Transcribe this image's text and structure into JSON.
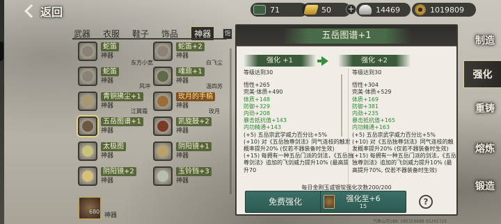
{
  "top": {
    "back_label": "返回",
    "currencies": [
      {
        "name": "ticket",
        "value": "71",
        "icon": "ticket-icon"
      },
      {
        "name": "gold-ingot",
        "value": "50",
        "icon": "gold-ingot-icon"
      },
      {
        "name": "silver",
        "value": "14469",
        "icon": "silver-ingot-icon"
      },
      {
        "name": "copper",
        "value": "1019809",
        "icon": "copper-coin-icon"
      }
    ],
    "plus": "+"
  },
  "categories": [
    {
      "label": "武器",
      "active": false
    },
    {
      "label": "衣服",
      "active": false
    },
    {
      "label": "鞋子",
      "active": false
    },
    {
      "label": "饰品",
      "active": false
    },
    {
      "label": "神器",
      "active": true
    }
  ],
  "filter_icon_label": "饱",
  "items": [
    {
      "name": "蛇笛",
      "type": "神器",
      "owner": "东方小宽"
    },
    {
      "name": "蛇笛+2",
      "type": "神器",
      "owner": "白飞尘"
    },
    {
      "name": "蛇笛",
      "type": "神器",
      "owner": "风冲"
    },
    {
      "name": "魂鼎+1",
      "type": "神器",
      "owner": "温四苏"
    },
    {
      "name": "青铜拂尘+1",
      "type": "神器",
      "owner": "江翼霜"
    },
    {
      "name": "玫月的手稿",
      "type": "神器",
      "owner": "玫月"
    },
    {
      "name": "五岳图谱+1",
      "type": "神器",
      "owner": ""
    },
    {
      "name": "凯旋鼓+2",
      "type": "神器",
      "owner": ""
    },
    {
      "name": "太极图",
      "type": "神器",
      "owner": ""
    },
    {
      "name": "阴阳镜+1",
      "type": "神器",
      "owner": ""
    },
    {
      "name": "阴阳镜+2",
      "type": "神器",
      "owner": ""
    },
    {
      "name": "玉铃铛+3",
      "type": "神器",
      "owner": ""
    }
  ],
  "bottom_item": {
    "count": "680",
    "type": "神器"
  },
  "panel": {
    "title": "五岳图谱+1",
    "left_head": "强化 +1",
    "right_head": "强化 +2",
    "left_lines": [
      {
        "t": "等级达到30",
        "c": ""
      },
      {
        "t": "",
        "c": "gap"
      },
      {
        "t": "悟性+265",
        "c": ""
      },
      {
        "t": "完美·体质+490",
        "c": ""
      },
      {
        "t": "体质+148",
        "c": "g"
      },
      {
        "t": "防御+329",
        "c": "g"
      },
      {
        "t": "内劲+208",
        "c": "g"
      },
      {
        "t": "暴击抵抗值+143",
        "c": "g"
      },
      {
        "t": "内功精通+143",
        "c": "g"
      },
      {
        "t": "(+5) 五岳宗武学威力百分比+5%",
        "c": ""
      },
      {
        "t": "(+10) 对《五岳独尊剑法》同气连枝的触发概率提升20% (仅若不器装备时生效)",
        "c": "wrap"
      },
      {
        "t": "(+15) 每拥有一种五岳门派的剑法，《五岳独尊剑法》追加的飞剑威力提升10% (最高提升70",
        "c": "wrap"
      }
    ],
    "right_lines": [
      {
        "t": "等级达到30",
        "c": ""
      },
      {
        "t": "",
        "c": "gap"
      },
      {
        "t": "悟性+304",
        "c": ""
      },
      {
        "t": "完美·体质+529",
        "c": ""
      },
      {
        "t": "体质+169",
        "c": "g"
      },
      {
        "t": "防御+381",
        "c": "g"
      },
      {
        "t": "内劲+235",
        "c": "g"
      },
      {
        "t": "暴击抵抗值+165",
        "c": "g"
      },
      {
        "t": "内功精通+163",
        "c": "g"
      },
      {
        "t": "(+5) 五岳宗武学威力百分比+5%",
        "c": ""
      },
      {
        "t": "(+10) 对《五岳独尊剑法》同气连枝的触发概率提升20% (仅若不器装备时生效)",
        "c": "wrap"
      },
      {
        "t": "(+15) 每拥有一种五岳门派的剑法，《五岳独尊剑法》追加的飞剑威力提升10% (最高提升70%, 仅若不器装备时生效)",
        "c": "wrap"
      }
    ],
    "limit_text": "每日金刚玉或银锭强化次数200/200",
    "free_btn": "免费强化",
    "up_btn": "强化至+6",
    "up_cost": "15",
    "help": "?"
  },
  "nav": [
    {
      "label": "制造",
      "active": false
    },
    {
      "label": "强化",
      "active": true
    },
    {
      "label": "重铸",
      "active": false
    },
    {
      "label": "熔炼",
      "active": false
    },
    {
      "label": "锻造",
      "active": false
    }
  ],
  "watermark": "气鱼山河189: 285359688 05291725"
}
